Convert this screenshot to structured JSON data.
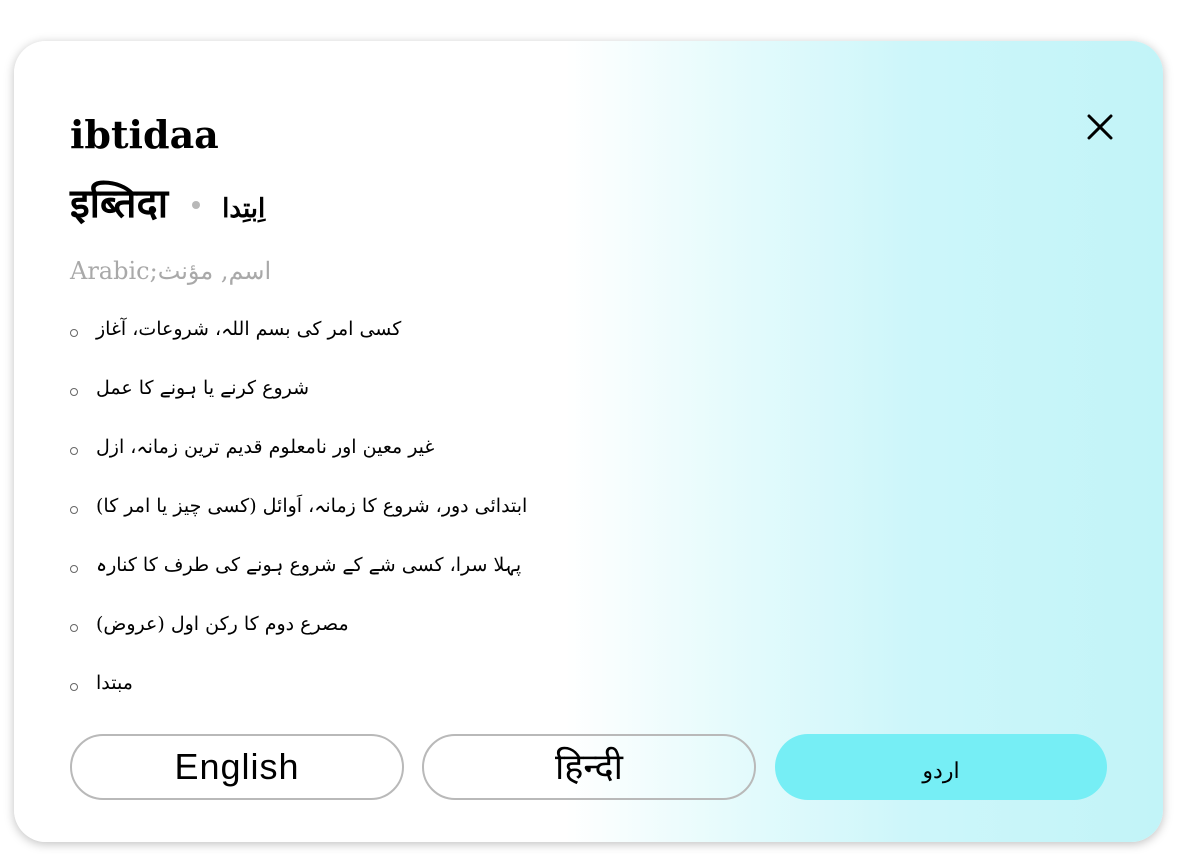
{
  "entry": {
    "word_roman": "ibtidaa",
    "word_hindi": "इब्तिदा",
    "word_urdu": "اِبتِدا",
    "grammar": "Arabic;اسم, مؤنث"
  },
  "meanings": [
    "کسی امر کی بسم اللہ، شروعات، آغاز",
    "شروع کرنے یا ہونے کا عمل",
    "غیر معین اور نامعلوم قدیم ترین زمانہ، ازل",
    "ابتدائی دور، شروع کا زمانہ، اَوائل (کسی چیز یا امر کا)",
    "پہلا سرا، کسی شے کے شروع ہونے کی طرف کا کنارہ",
    "مصرع دوم کا رکن اول (عروض)",
    "مبتدا"
  ],
  "language_buttons": {
    "english": "English",
    "hindi": "हिन्दी",
    "urdu": "اردو",
    "selected": "urdu"
  },
  "colors": {
    "selected_button": "#76eef5",
    "gradient_end": "#c2f4f8",
    "muted_text": "#a9a9a9"
  },
  "icons": {
    "close": "close-icon"
  }
}
